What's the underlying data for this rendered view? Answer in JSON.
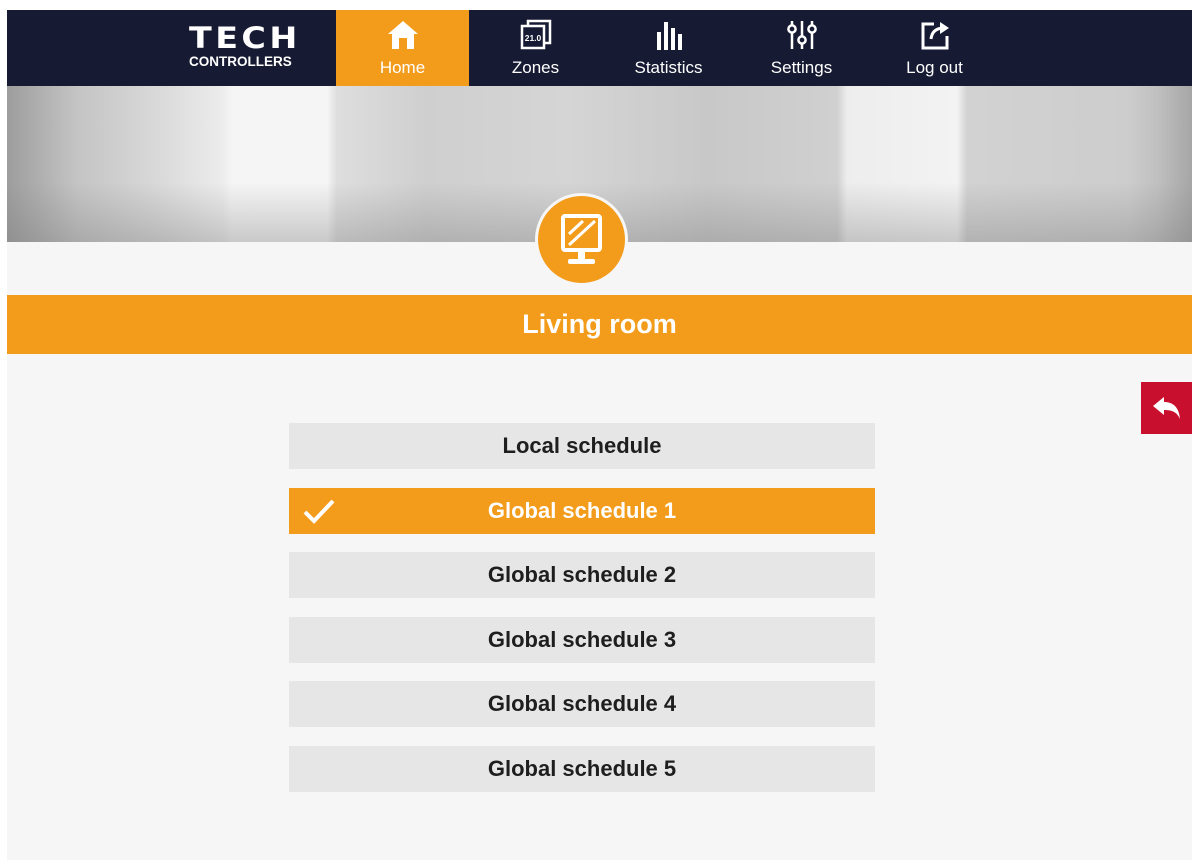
{
  "brand": {
    "logo_word": "TECH",
    "logo_sub": "CONTROLLERS"
  },
  "nav": {
    "items": [
      {
        "label": "Home",
        "icon": "home-icon",
        "active": true
      },
      {
        "label": "Zones",
        "icon": "zone-display-icon",
        "badge": "21.0",
        "active": false
      },
      {
        "label": "Statistics",
        "icon": "bar-chart-icon",
        "active": false
      },
      {
        "label": "Settings",
        "icon": "sliders-icon",
        "active": false
      },
      {
        "label": "Log out",
        "icon": "logout-icon",
        "active": false
      }
    ]
  },
  "zone": {
    "title": "Living room",
    "icon": "thermostat-panel-icon"
  },
  "back": {
    "icon": "back-arrow-icon"
  },
  "schedules": {
    "options": [
      {
        "label": "Local schedule",
        "selected": false
      },
      {
        "label": "Global schedule 1",
        "selected": true
      },
      {
        "label": "Global schedule 2",
        "selected": false
      },
      {
        "label": "Global schedule 3",
        "selected": false
      },
      {
        "label": "Global schedule 4",
        "selected": false
      },
      {
        "label": "Global schedule 5",
        "selected": false
      }
    ]
  },
  "colors": {
    "accent": "#f39c1b",
    "nav_background": "#161a33",
    "back_button": "#c8102e",
    "option_background": "#e6e6e6"
  }
}
